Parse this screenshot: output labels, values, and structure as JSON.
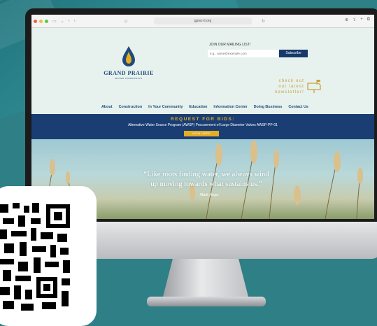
{
  "browser": {
    "url": "gpwc-tl.org",
    "icons": [
      "sidebar-icon",
      "back-icon",
      "forward-icon",
      "shield-icon",
      "reload-icon",
      "download-icon",
      "share-icon",
      "new-tab-icon",
      "tabs-icon"
    ]
  },
  "site": {
    "logo_name": "Grand Prairie",
    "logo_sub": "Water Commission",
    "mailing": {
      "label": "JOIN OUR MAILING LIST!",
      "placeholder": "e.g., name@example.com",
      "button": "Subscribe"
    },
    "newsletter": {
      "line1": "check out",
      "line2": "our latest",
      "line3": "newsletter!"
    },
    "nav": [
      "About",
      "Construction",
      "In Your Community",
      "Education",
      "Information Center",
      "Doing Business",
      "Contact Us"
    ],
    "banner": {
      "title": "REQUEST FOR BIDS:",
      "subtitle": "Alternative Water Source Program (AWSP) Procurement of Large Diameter Valves AWSP-PP-01",
      "button": "VIEW HERE"
    },
    "hero": {
      "quote_line1": "“Like roots finding water, we always wind",
      "quote_line2": "up moving towards what sustains us.”",
      "author": "Mark Nepo"
    }
  },
  "colors": {
    "brand_navy": "#1a3e74",
    "accent_gold": "#e3ad24",
    "page_teal": "#2e7f86"
  }
}
